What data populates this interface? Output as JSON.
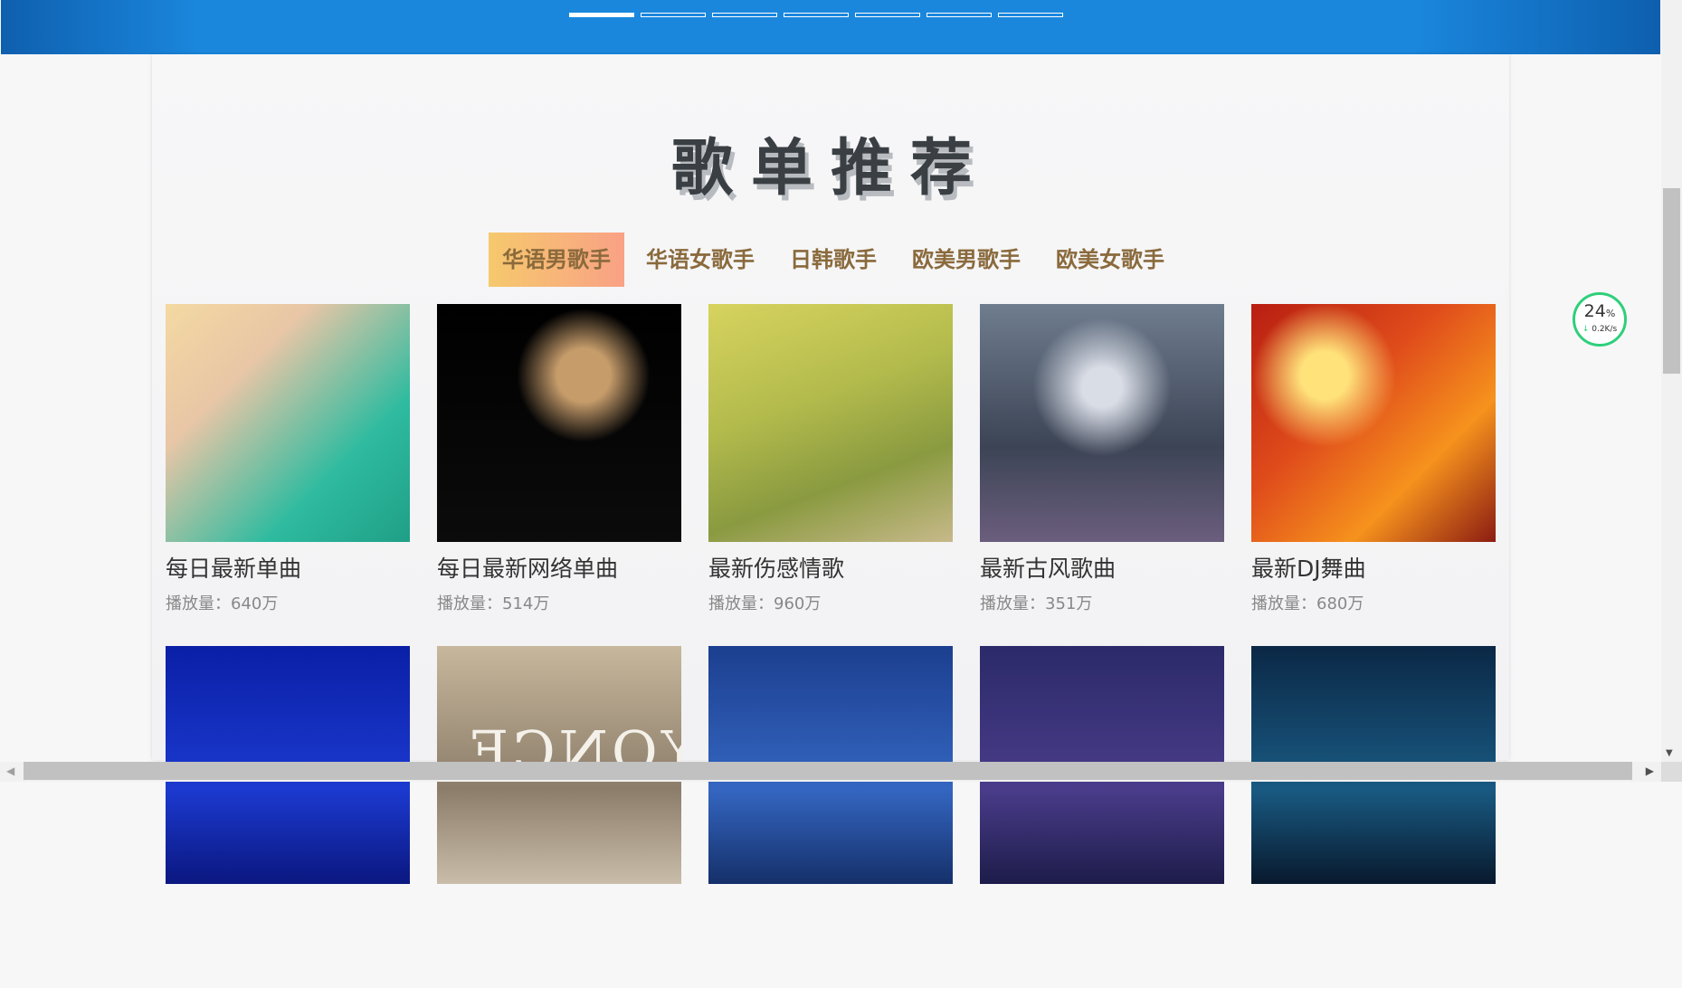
{
  "carousel": {
    "slide_count": 7,
    "active_index": 0
  },
  "section": {
    "title": "歌单推荐"
  },
  "tabs": [
    {
      "label": "华语男歌手",
      "active": true
    },
    {
      "label": "华语女歌手",
      "active": false
    },
    {
      "label": "日韩歌手",
      "active": false
    },
    {
      "label": "欧美男歌手",
      "active": false
    },
    {
      "label": "欧美女歌手",
      "active": false
    }
  ],
  "playlists": [
    {
      "title": "每日最新单曲",
      "plays": "播放量：640万",
      "art": "art-0"
    },
    {
      "title": "每日最新网络单曲",
      "plays": "播放量：514万",
      "art": "art-1"
    },
    {
      "title": "最新伤感情歌",
      "plays": "播放量：960万",
      "art": "art-2"
    },
    {
      "title": "最新古风歌曲",
      "plays": "播放量：351万",
      "art": "art-3"
    },
    {
      "title": "最新DJ舞曲",
      "plays": "播放量：680万",
      "art": "art-4"
    },
    {
      "title": "",
      "plays": "",
      "art": "art-5"
    },
    {
      "title": "",
      "plays": "",
      "art": "art-6",
      "watermark": "BEYONCE"
    },
    {
      "title": "",
      "plays": "",
      "art": "art-7"
    },
    {
      "title": "",
      "plays": "",
      "art": "art-8"
    },
    {
      "title": "",
      "plays": "",
      "art": "art-9"
    }
  ],
  "speed_widget": {
    "percent": "24",
    "percent_unit": "%",
    "rate": "0.2K/s",
    "accent": "#2fcf7a"
  },
  "colors": {
    "banner": "#1a87dd",
    "tab_active_start": "#f6c96d",
    "tab_active_end": "#f9a185",
    "tab_text": "#8a6a3c"
  }
}
